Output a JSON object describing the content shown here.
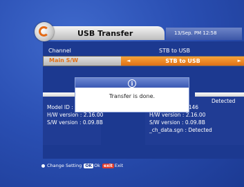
{
  "header": {
    "title": "USB Transfer",
    "clock": "13/Sep. PM 12:58"
  },
  "rows": [
    {
      "label": "Channel",
      "value": "STB to USB"
    },
    {
      "label": "Main S/W",
      "value": "STB to USB",
      "left_arrow": "◄",
      "right_arrow": "►"
    }
  ],
  "left_info": {
    "lines": [
      "Model ID : /e0a146",
      "H/W version : 2.16.00",
      "S/W version : 0.09.8B"
    ]
  },
  "right_info": {
    "status": "Detected",
    "lines": [
      "Model ID : /e0a146",
      "H/W version : 2.16.00",
      "S/W version : 0.09.8B",
      "_ch_data.sgn : Detected"
    ]
  },
  "popup": {
    "icon": "i",
    "message": "Transfer is done."
  },
  "footer": {
    "change_label": "Change Setting",
    "ok_key": "OK",
    "ok_label": "Ok",
    "exit_key": "exit",
    "exit_label": "Exit"
  },
  "colors": {
    "background": "#2a4fb3",
    "highlight": "#e07016"
  }
}
